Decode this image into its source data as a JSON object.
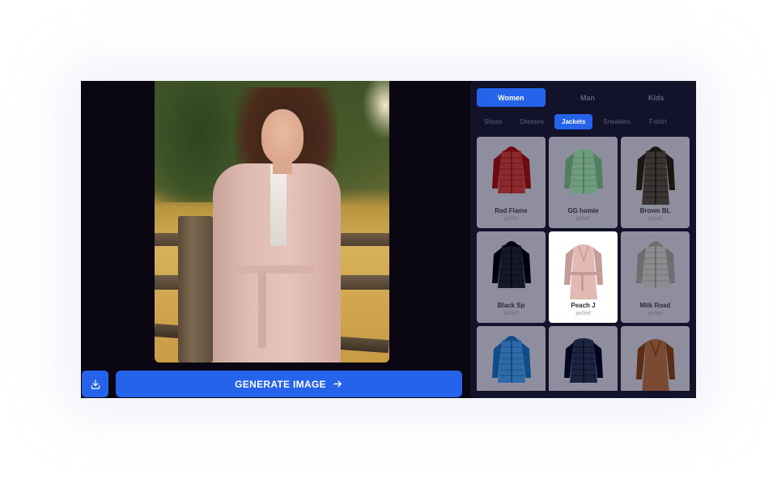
{
  "actions": {
    "download_icon": "download-icon",
    "generate_label": "GENERATE IMAGE",
    "generate_icon": "arrow-right-icon"
  },
  "preview": {
    "description": "Woman wearing pink belted coat leaning on wooden fence in a golden field"
  },
  "gender_tabs": [
    {
      "label": "Women",
      "active": true
    },
    {
      "label": "Man",
      "active": false
    },
    {
      "label": "Kids",
      "active": false
    }
  ],
  "category_tabs": [
    {
      "label": "Shoes",
      "active": false
    },
    {
      "label": "Dresses",
      "active": false
    },
    {
      "label": "Jackets",
      "active": true
    },
    {
      "label": "Sneakers",
      "active": false
    },
    {
      "label": "T-shirt",
      "active": false
    }
  ],
  "products": [
    {
      "name": "Red Flame",
      "type": "jacket",
      "color": "#8a2a2e",
      "style": "puffer",
      "selected": false
    },
    {
      "name": "GG homie",
      "type": "jacket",
      "color": "#6f9c7c",
      "style": "quilted",
      "selected": false
    },
    {
      "name": "Brown BL",
      "type": "jacket",
      "color": "#3a3533",
      "style": "long-puffer",
      "selected": false
    },
    {
      "name": "Black Sp",
      "type": "jacket",
      "color": "#151828",
      "style": "puffer",
      "selected": false
    },
    {
      "name": "Peach J",
      "type": "jacket",
      "color": "#e2b9b3",
      "style": "coat",
      "selected": true
    },
    {
      "name": "Milk Road",
      "type": "jacket",
      "color": "#8c8c8e",
      "style": "puffer",
      "selected": false
    },
    {
      "name": "",
      "type": "",
      "color": "#2e6aa8",
      "style": "parka",
      "selected": false
    },
    {
      "name": "",
      "type": "",
      "color": "#1c2440",
      "style": "quilted",
      "selected": false
    },
    {
      "name": "",
      "type": "",
      "color": "#7a4a33",
      "style": "coat",
      "selected": false
    }
  ],
  "colors": {
    "accent": "#2563eb",
    "panel_bg": "#12132a",
    "app_bg": "#0a0713",
    "card_bg": "#8e8e9e",
    "card_selected_bg": "#ffffff"
  }
}
